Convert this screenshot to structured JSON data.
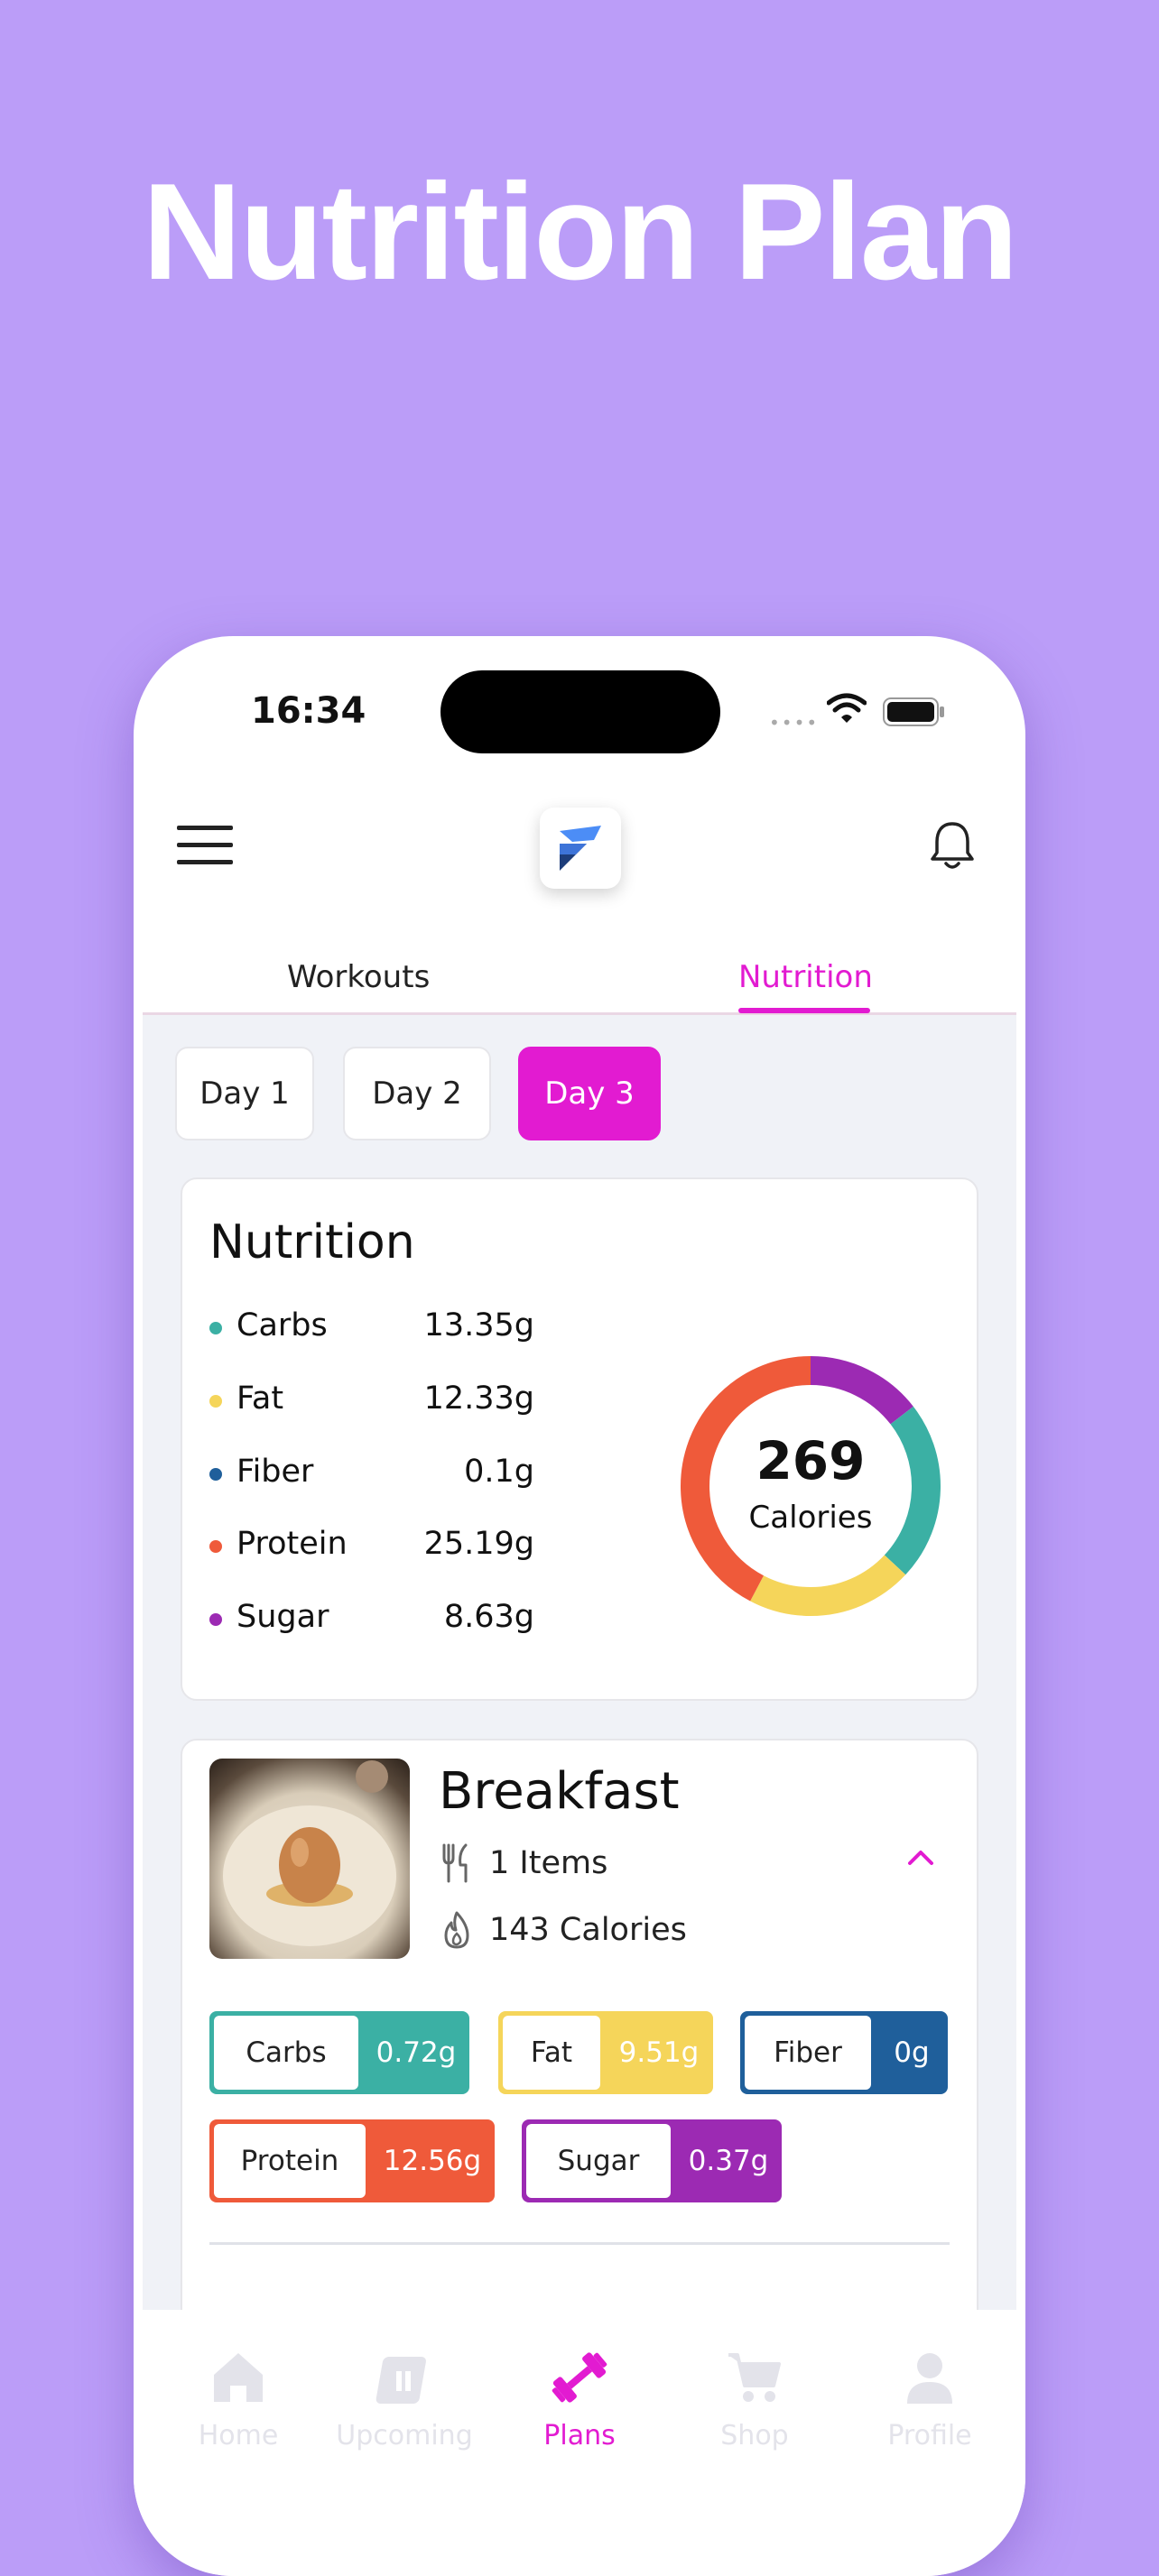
{
  "hero": {
    "title": "Nutrition Plan"
  },
  "status_bar": {
    "time": "16:34"
  },
  "tabs": [
    {
      "label": "Workouts"
    },
    {
      "label": "Nutrition",
      "active": true
    }
  ],
  "days": [
    {
      "label": "Day 1"
    },
    {
      "label": "Day 2"
    },
    {
      "label": "Day 3",
      "active": true
    }
  ],
  "nutrition": {
    "title": "Nutrition",
    "items": [
      {
        "label": "Carbs",
        "value": "13.35g",
        "color": "#3bb0a4"
      },
      {
        "label": "Fat",
        "value": "12.33g",
        "color": "#f5d55a"
      },
      {
        "label": "Fiber",
        "value": "0.1g",
        "color": "#1f5f9b"
      },
      {
        "label": "Protein",
        "value": "25.19g",
        "color": "#ef5a3a"
      },
      {
        "label": "Sugar",
        "value": "8.63g",
        "color": "#9c2ab3"
      }
    ],
    "total_calories": "269",
    "calories_label": "Calories"
  },
  "breakfast": {
    "title": "Breakfast",
    "items_count": "1 Items",
    "calories": "143 Calories",
    "macros": [
      {
        "label": "Carbs",
        "value": "0.72g",
        "color": "#3bb0a4"
      },
      {
        "label": "Fat",
        "value": "9.51g",
        "color": "#f5d55a"
      },
      {
        "label": "Fiber",
        "value": "0g",
        "color": "#1f5f9b"
      },
      {
        "label": "Protein",
        "value": "12.56g",
        "color": "#ef5a3a"
      },
      {
        "label": "Sugar",
        "value": "0.37g",
        "color": "#9c2ab3"
      }
    ]
  },
  "bottom_nav": [
    {
      "label": "Home",
      "icon": "home-icon"
    },
    {
      "label": "Upcoming",
      "icon": "calendar-icon"
    },
    {
      "label": "Plans",
      "icon": "dumbbell-icon",
      "active": true
    },
    {
      "label": "Shop",
      "icon": "cart-icon"
    },
    {
      "label": "Profile",
      "icon": "profile-icon"
    }
  ],
  "colors": {
    "background": "#bb9df8",
    "accent": "#e21bd1"
  }
}
